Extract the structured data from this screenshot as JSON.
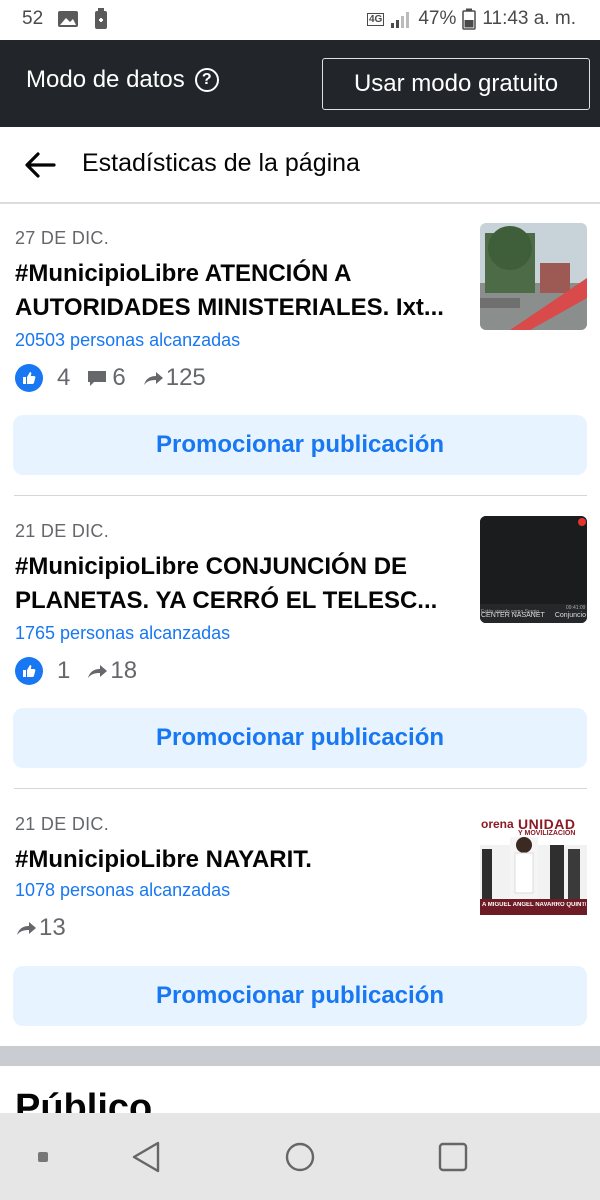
{
  "status_bar": {
    "notification_count": "52",
    "network": "4G",
    "battery": "47%",
    "time": "11:43 a. m."
  },
  "data_mode": {
    "label": "Modo de datos",
    "button": "Usar modo gratuito"
  },
  "header": {
    "title": "Estadísticas de la página"
  },
  "posts": [
    {
      "date": "27 DE DIC.",
      "headline": "#MunicipioLibre ATENCIÓN A AUTORIDADES MINISTERIALES. Ixt...",
      "reach": "20503 personas alcanzadas",
      "likes": "4",
      "comments": "6",
      "shares": "125",
      "promote": "Promocionar publicación"
    },
    {
      "date": "21 DE DIC.",
      "headline": "#MunicipioLibre CONJUNCIÓN DE PLANETAS. YA CERRÓ EL TELESC...",
      "reach": "1765 personas alcanzadas",
      "likes": "1",
      "shares": "18",
      "promote": "Promocionar publicación",
      "thumb_caption_left": "CENTER  NASANET",
      "thumb_caption_right": "Conjuncio"
    },
    {
      "date": "21 DE DIC.",
      "headline": "#MunicipioLibre NAYARIT.",
      "reach": "1078 personas alcanzadas",
      "shares": "13",
      "promote": "Promocionar publicación",
      "thumb_brand": "orena",
      "thumb_banner_1": "UNIDAD",
      "thumb_banner_2": "Y MOVILIZACIÓN",
      "thumb_caption": "A MIGUEL ÁNGEL NAVARRO QUINTERO"
    }
  ],
  "section": {
    "title": "Público"
  },
  "colors": {
    "accent": "#1877f2",
    "promo_bg": "#e7f3ff",
    "dark_bar": "#22252a"
  }
}
